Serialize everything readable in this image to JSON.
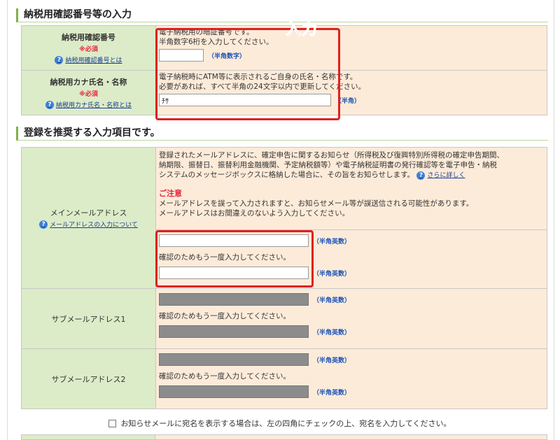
{
  "section1": {
    "heading": "納税用確認番号等の入力",
    "pin": {
      "label": "納税用確認番号",
      "required": "※必須",
      "help_link": "納税用確認番号とは",
      "desc_1": "電子納税用の暗証番号です。",
      "desc_2": "半角数字6桁を入力してください。",
      "value": "",
      "hint": "（半角数字）"
    },
    "kana": {
      "label": "納税用カナ氏名・名称",
      "required": "※必須",
      "help_link": "納税用カナ氏名・名称とは",
      "desc_1": "電子納税時にATM等に表示されるご自身の氏名・名称です。",
      "desc_2": "必要があれば、すべて半角の24文字以内で更新してください。",
      "value": "ﾁｻ",
      "hint": "（半角）"
    }
  },
  "annotation": {
    "label": "入力",
    "color": "#e02020"
  },
  "section2": {
    "heading": "登録を推奨する入力項目です。",
    "main_email": {
      "label": "メインメールアドレス",
      "help_link": "メールアドレスの入力について",
      "desc_1": "登録されたメールアドレスに、確定申告に関するお知らせ（所得税及び復興特別所得税の確定申告期間、",
      "desc_2": "納期限、振替日、振替利用金融機関、予定納税額等）や電子納税証明書の発行確認等を電子申告・納税",
      "desc_3": "システムのメッセージボックスに格納した場合に、その旨をお知らせします。",
      "more_link": "さらに詳しく",
      "caution_title": "ご注意",
      "caution_1": "メールアドレスを誤って入力されますと、お知らせメール等が誤送信される可能性があります。",
      "caution_2": "メールアドレスはお間違えのないよう入力してください。",
      "email_value": "",
      "email_hint": "（半角英数）",
      "confirm_text": "確認のためもう一度入力してください。",
      "confirm_value": "",
      "confirm_hint": "（半角英数）"
    },
    "sub_email_1": {
      "label": "サブメールアドレス1",
      "email_hint": "（半角英数）",
      "confirm_text": "確認のためもう一度入力してください。",
      "confirm_hint": "（半角英数）"
    },
    "sub_email_2": {
      "label": "サブメールアドレス2",
      "email_hint": "（半角英数）",
      "confirm_text": "確認のためもう一度入力してください。",
      "confirm_hint": "（半角英数）"
    }
  },
  "notice": {
    "text": "お知らせメールに宛名を表示する場合は、左の四角にチェックの上、宛名を入力してください。",
    "checked": false
  },
  "colors": {
    "label_bg": "#dcecc8",
    "value_bg": "#fdebd9",
    "accent_green": "#7fb24a",
    "link_blue": "#1a3d8f"
  }
}
